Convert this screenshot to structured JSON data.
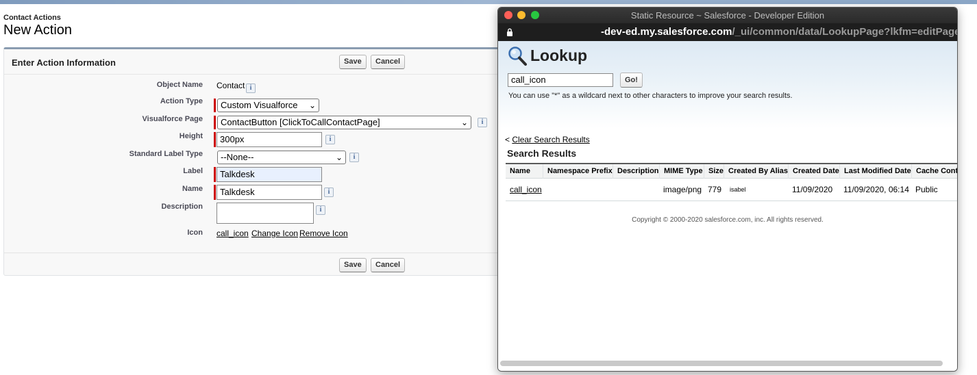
{
  "page": {
    "breadcrumb": "Contact Actions",
    "title": "New Action"
  },
  "panel": {
    "title": "Enter Action Information",
    "save_label": "Save",
    "cancel_label": "Cancel"
  },
  "form": {
    "object_name_label": "Object Name",
    "object_name_value": "Contact",
    "action_type_label": "Action Type",
    "action_type_value": "Custom Visualforce",
    "vf_page_label": "Visualforce Page",
    "vf_page_value": "ContactButton [ClickToCallContactPage]",
    "height_label": "Height",
    "height_value": "300px",
    "std_label_type_label": "Standard Label Type",
    "std_label_type_value": "--None--",
    "label_label": "Label",
    "label_value": "Talkdesk",
    "name_label": "Name",
    "name_value": "Talkdesk",
    "description_label": "Description",
    "description_value": "",
    "icon_label": "Icon",
    "icon_value": "call_icon",
    "change_icon": "Change Icon",
    "remove_icon": "Remove Icon",
    "info_glyph": "i"
  },
  "popup": {
    "window_title": "Static Resource ~ Salesforce - Developer Edition",
    "url_host": "-dev-ed.my.salesforce.com",
    "url_path": "/_ui/common/data/LookupPage?lkfm=editPage...",
    "lookup_title": "Lookup",
    "search_value": "call_icon",
    "go_label": "Go!",
    "help_text": "You can use \"*\" as a wildcard next to other characters to improve your search results.",
    "clear_prefix": "<",
    "clear_link": "Clear Search Results",
    "results_title": "Search Results",
    "columns": [
      "Name",
      "Namespace Prefix",
      "Description",
      "MIME Type",
      "Size",
      "Created By Alias",
      "Created Date",
      "Last Modified Date",
      "Cache Cont"
    ],
    "rows": [
      {
        "name": "call_icon",
        "namespace": "",
        "description": "",
        "mime": "image/png",
        "size": "779",
        "alias": "isabel",
        "created": "11/09/2020",
        "modified": "11/09/2020, 06:14",
        "cache": "Public"
      }
    ],
    "copyright": "Copyright © 2000-2020 salesforce.com, inc. All rights reserved."
  },
  "colors": {
    "required_bar": "#cc0000",
    "panel_border": "#8a9cb0",
    "lookup_band": "#dde9f4"
  },
  "icons": [
    "info-icon",
    "lock-icon",
    "magnifier-icon"
  ]
}
